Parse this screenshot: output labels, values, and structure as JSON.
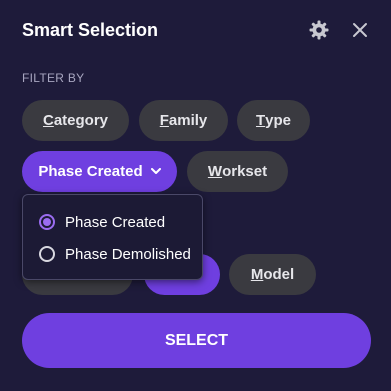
{
  "header": {
    "title": "Smart Selection",
    "settings_icon": "gear-icon",
    "close_icon": "close-icon"
  },
  "filter": {
    "label": "FILTER BY",
    "chips_row1": [
      {
        "label_first": "C",
        "label_rest": "ategory"
      },
      {
        "label_first": "F",
        "label_rest": "amily"
      },
      {
        "label_first": "T",
        "label_rest": "ype"
      }
    ],
    "chips_row2": [
      {
        "label": "Phase Created",
        "active": true,
        "icon": "chevron-down-icon"
      },
      {
        "label_first": "W",
        "label_rest": "orkset"
      }
    ],
    "chips_row3": [
      {
        "label_first": "M",
        "label_rest": "odel"
      }
    ]
  },
  "dropdown": {
    "options": [
      {
        "label": "Phase Created",
        "selected": true
      },
      {
        "label": "Phase Demolished",
        "selected": false
      }
    ]
  },
  "actions": {
    "select_label": "SELECT"
  },
  "colors": {
    "background": "#1e1b3a",
    "accent": "#6f3fe0",
    "chip": "#3a3a40",
    "radio_accent": "#9a6cf0"
  }
}
